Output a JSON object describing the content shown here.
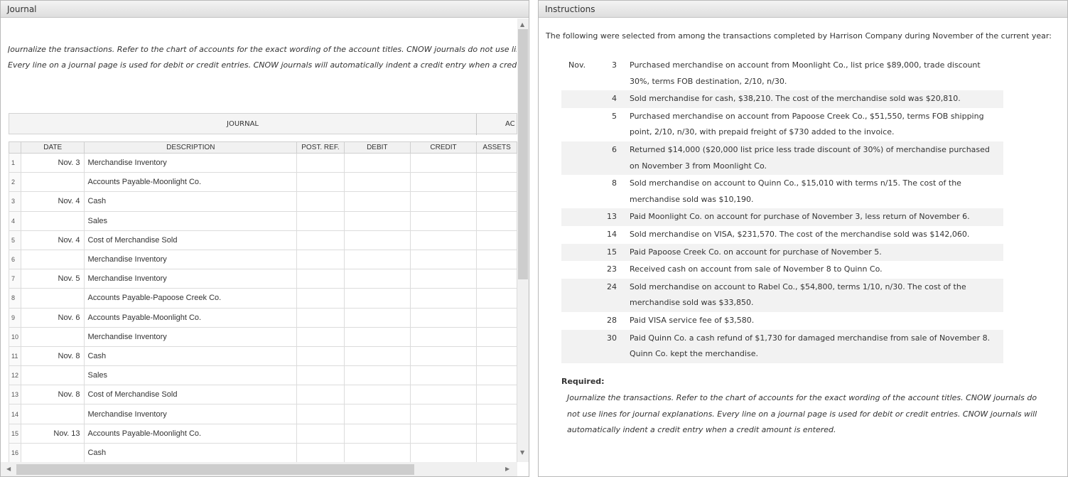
{
  "journal_panel": {
    "header": "Journal",
    "instruction_line1": "Journalize the transactions. Refer to the chart of accounts for the exact wording of the account titles. CNOW journals do not use lines",
    "instruction_line2": "Every line on a journal page is used for debit or credit entries. CNOW journals will automatically indent a credit entry when a credit a",
    "journal_title": "JOURNAL",
    "sub_header": "AC",
    "columns": [
      "",
      "DATE",
      "DESCRIPTION",
      "POST. REF.",
      "DEBIT",
      "CREDIT",
      "ASSETS"
    ],
    "rows": [
      {
        "n": "1",
        "date": "Nov. 3",
        "desc": "Merchandise Inventory"
      },
      {
        "n": "2",
        "date": "",
        "desc": "Accounts Payable-Moonlight Co."
      },
      {
        "n": "3",
        "date": "Nov. 4",
        "desc": "Cash"
      },
      {
        "n": "4",
        "date": "",
        "desc": "Sales"
      },
      {
        "n": "5",
        "date": "Nov. 4",
        "desc": "Cost of Merchandise Sold"
      },
      {
        "n": "6",
        "date": "",
        "desc": "Merchandise Inventory"
      },
      {
        "n": "7",
        "date": "Nov. 5",
        "desc": "Merchandise Inventory"
      },
      {
        "n": "8",
        "date": "",
        "desc": "Accounts Payable-Papoose Creek Co."
      },
      {
        "n": "9",
        "date": "Nov. 6",
        "desc": "Accounts Payable-Moonlight Co."
      },
      {
        "n": "10",
        "date": "",
        "desc": "Merchandise Inventory"
      },
      {
        "n": "11",
        "date": "Nov. 8",
        "desc": "Cash"
      },
      {
        "n": "12",
        "date": "",
        "desc": "Sales"
      },
      {
        "n": "13",
        "date": "Nov. 8",
        "desc": "Cost of Merchandise Sold"
      },
      {
        "n": "14",
        "date": "",
        "desc": "Merchandise Inventory"
      },
      {
        "n": "15",
        "date": "Nov. 13",
        "desc": "Accounts Payable-Moonlight Co."
      },
      {
        "n": "16",
        "date": "",
        "desc": "Cash"
      }
    ]
  },
  "instructions_panel": {
    "header": "Instructions",
    "intro": "The following were selected from among the transactions completed by Harrison Company during November of the current year:",
    "month": "Nov.",
    "transactions": [
      {
        "day": "3",
        "text": "Purchased merchandise on account from Moonlight Co., list price $89,000, trade discount 30%, terms FOB destination, 2/10, n/30."
      },
      {
        "day": "4",
        "text": "Sold merchandise for cash, $38,210. The cost of the merchandise sold was $20,810."
      },
      {
        "day": "5",
        "text": "Purchased merchandise on account from Papoose Creek Co., $51,550, terms FOB shipping point, 2/10, n/30, with prepaid freight of $730 added to the invoice."
      },
      {
        "day": "6",
        "text": "Returned $14,000 ($20,000 list price less trade discount of 30%) of merchandise purchased on November 3 from Moonlight Co."
      },
      {
        "day": "8",
        "text": "Sold merchandise on account to Quinn Co., $15,010 with terms n/15. The cost of the merchandise sold was $10,190."
      },
      {
        "day": "13",
        "text": "Paid Moonlight Co. on account for purchase of November 3, less return of November 6."
      },
      {
        "day": "14",
        "text": "Sold merchandise on VISA, $231,570. The cost of the merchandise sold was $142,060."
      },
      {
        "day": "15",
        "text": "Paid Papoose Creek Co. on account for purchase of November 5."
      },
      {
        "day": "23",
        "text": "Received cash on account from sale of November 8 to Quinn Co."
      },
      {
        "day": "24",
        "text": "Sold merchandise on account to Rabel Co., $54,800, terms 1/10, n/30. The cost of the merchandise sold was $33,850."
      },
      {
        "day": "28",
        "text": "Paid VISA service fee of $3,580."
      },
      {
        "day": "30",
        "text": "Paid Quinn Co. a cash refund of $1,730 for damaged merchandise from sale of November 8. Quinn Co. kept the merchandise."
      }
    ],
    "required_label": "Required:",
    "required_text": "Journalize the transactions. Refer to the chart of accounts for the exact wording of the account titles. CNOW journals do not use lines for journal explanations. Every line on a journal page is used for debit or credit entries. CNOW journals will automatically indent a credit entry when a credit amount is entered."
  }
}
